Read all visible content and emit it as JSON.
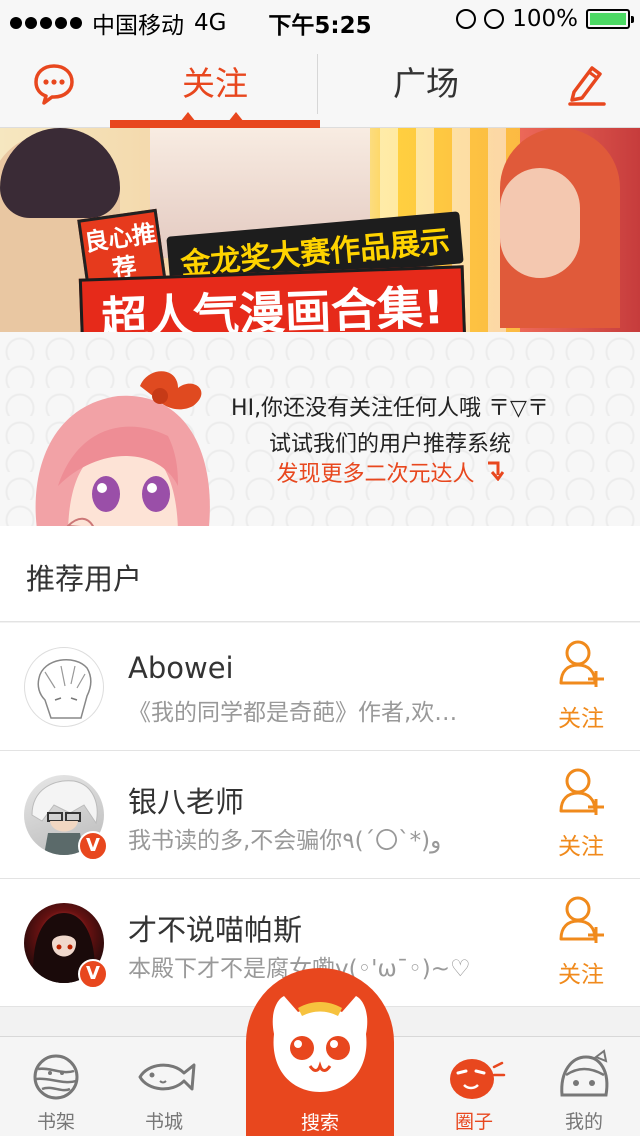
{
  "status_bar": {
    "carrier": "中国移动",
    "network": "4G",
    "time": "下午5:25",
    "battery": "100%",
    "battery_level": 1.0
  },
  "nav": {
    "tab_follow": "关注",
    "tab_plaza": "广场",
    "active_tab": "关注",
    "accent_color": "#e8471e"
  },
  "banner": {
    "badge": "良心推荐",
    "subtitle": "金龙奖大赛作品展示",
    "title": "超人气漫画合集!"
  },
  "empty_state": {
    "line1": "HI,你还没有关注任何人哦 〒▽〒",
    "line2": "试试我们的用户推荐系统",
    "line3": "发现更多二次元达人"
  },
  "recommend": {
    "title": "推荐用户",
    "users": [
      {
        "name": "Abowei",
        "desc": "《我的同学都是奇葩》作者,欢…",
        "follow": "关注",
        "verified": false
      },
      {
        "name": "银八老师",
        "desc": "我书读的多,不会骗你٩(´〇`*)و",
        "follow": "关注",
        "verified": true,
        "badge": "V"
      },
      {
        "name": "才不说喵帕斯",
        "desc": "本殿下才不是腐女嘞v(◦'ω¯◦)~♡",
        "follow": "关注",
        "verified": true,
        "badge": "V"
      }
    ]
  },
  "tabbar": {
    "shelf": "书架",
    "store": "书城",
    "search": "搜索",
    "circle": "圈子",
    "mine": "我的",
    "active": "圈子"
  }
}
